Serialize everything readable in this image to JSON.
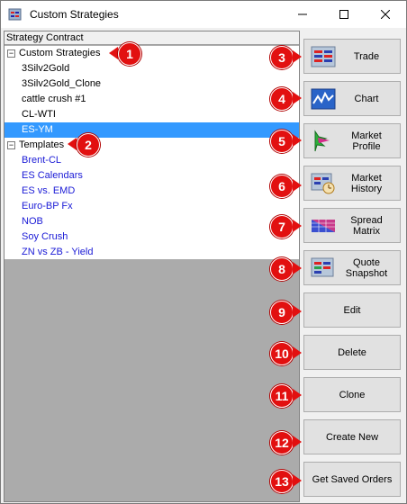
{
  "window": {
    "title": "Custom Strategies"
  },
  "tree": {
    "header": "Strategy Contract",
    "groups": [
      {
        "label": "Custom Strategies",
        "expander": "−",
        "badge": "1",
        "items": [
          "3Silv2Gold",
          "3Silv2Gold_Clone",
          "cattle crush #1",
          "CL-WTI",
          "ES-YM"
        ],
        "selected": "ES-YM"
      },
      {
        "label": "Templates",
        "expander": "−",
        "badge": "2",
        "items": [
          "Brent-CL",
          "ES Calendars",
          "ES vs. EMD",
          "Euro-BP Fx",
          "NOB",
          "Soy Crush",
          "ZN vs ZB - Yield"
        ]
      }
    ]
  },
  "buttons": [
    {
      "badge": "3",
      "label": "Trade",
      "icon": "trade-icon"
    },
    {
      "badge": "4",
      "label": "Chart",
      "icon": "chart-icon"
    },
    {
      "badge": "5",
      "label": "Market Profile",
      "icon": "market-profile-icon"
    },
    {
      "badge": "6",
      "label": "Market History",
      "icon": "market-history-icon"
    },
    {
      "badge": "7",
      "label": "Spread Matrix",
      "icon": "spread-matrix-icon"
    },
    {
      "badge": "8",
      "label": "Quote Snapshot",
      "icon": "quote-snapshot-icon"
    },
    {
      "badge": "9",
      "label": "Edit"
    },
    {
      "badge": "10",
      "label": "Delete"
    },
    {
      "badge": "11",
      "label": "Clone"
    },
    {
      "badge": "12",
      "label": "Create New"
    },
    {
      "badge": "13",
      "label": "Get Saved Orders"
    }
  ],
  "colors": {
    "badge": "#e21010",
    "selection": "#3399ff",
    "template_text": "#1a1ad6"
  }
}
